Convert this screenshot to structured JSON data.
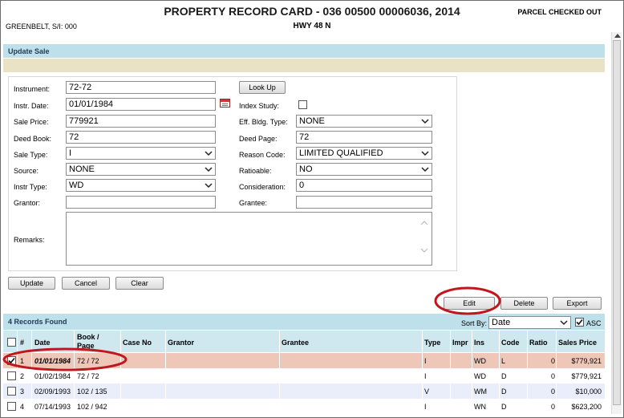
{
  "header": {
    "title": "PROPERTY RECORD CARD - 036 00500 00006036, 2014",
    "subtitle": "HWY 48 N",
    "owner": "GREENBELT, S/I: 000",
    "status": "PARCEL CHECKED OUT"
  },
  "section_title": "Update Sale",
  "form": {
    "instrument_label": "Instrument:",
    "instrument_value": "72-72",
    "lookup_label": "Look Up",
    "instr_date_label": "Instr. Date:",
    "instr_date_value": "01/01/1984",
    "index_study_label": "Index Study:",
    "sale_price_label": "Sale Price:",
    "sale_price_value": "779921",
    "eff_bldg_type_label": "Eff. Bldg. Type:",
    "eff_bldg_type_value": "NONE",
    "deed_book_label": "Deed Book:",
    "deed_book_value": "72",
    "deed_page_label": "Deed Page:",
    "deed_page_value": "72",
    "sale_type_label": "Sale Type:",
    "sale_type_value": "I",
    "reason_code_label": "Reason Code:",
    "reason_code_value": "LIMITED QUALIFIED",
    "source_label": "Source:",
    "source_value": "NONE",
    "ratioable_label": "Ratioable:",
    "ratioable_value": "NO",
    "instr_type_label": "Instr Type:",
    "instr_type_value": "WD",
    "consideration_label": "Consideration:",
    "consideration_value": "0",
    "grantor_label": "Grantor:",
    "grantor_value": "",
    "grantee_label": "Grantee:",
    "grantee_value": "",
    "remarks_label": "Remarks:",
    "remarks_value": ""
  },
  "buttons": {
    "update": "Update",
    "cancel": "Cancel",
    "clear": "Clear",
    "edit": "Edit",
    "delete": "Delete",
    "export": "Export"
  },
  "records": {
    "count_label": "4 Records Found",
    "sort_by_label": "Sort By:",
    "sort_by_value": "Date",
    "asc_label": "ASC",
    "columns": [
      "#",
      "Date",
      "Book / Page",
      "Case No",
      "Grantor",
      "Grantee",
      "Type",
      "Impr",
      "Ins",
      "Code",
      "Ratio",
      "Sales Price"
    ],
    "rows": [
      {
        "num": "1",
        "date": "01/01/1984",
        "book_page": "72 / 72",
        "type": "I",
        "ins": "WD",
        "code": "L",
        "ratio": "0",
        "price": "$779,921",
        "checked": true
      },
      {
        "num": "2",
        "date": "01/02/1984",
        "book_page": "72 / 72",
        "type": "I",
        "ins": "WD",
        "code": "D",
        "ratio": "0",
        "price": "$779,921",
        "checked": false
      },
      {
        "num": "3",
        "date": "02/09/1993",
        "book_page": "102 / 135",
        "type": "V",
        "ins": "WM",
        "code": "D",
        "ratio": "0",
        "price": "$10,000",
        "checked": false
      },
      {
        "num": "4",
        "date": "07/14/1993",
        "book_page": "102 / 942",
        "type": "I",
        "ins": "WN",
        "code": "D",
        "ratio": "0",
        "price": "$623,200",
        "checked": false
      }
    ]
  },
  "colors": {
    "selected_row": "#efc7b8",
    "alt_row": "#e9eefa",
    "annotation": "#c0171c",
    "bar": "#bde0ea"
  }
}
